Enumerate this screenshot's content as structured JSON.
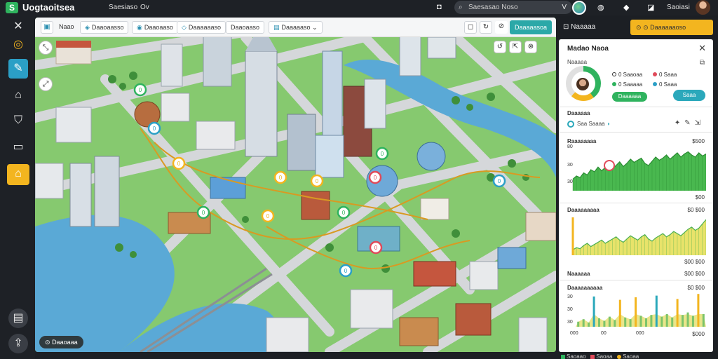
{
  "app": {
    "title": "Uogtaoitsea",
    "logo": "S"
  },
  "topbar": {
    "menu": [
      "Saesiaso",
      "Ov"
    ],
    "search_placeholder": "Saesasao Noso",
    "search_close": "V",
    "user_label": "Saoiasi"
  },
  "rail": {
    "icons": [
      "close-icon",
      "compass-icon",
      "ruler-icon",
      "layers-icon",
      "shield-icon",
      "tablet-icon",
      "building-icon",
      "save-icon",
      "share-icon"
    ]
  },
  "map_toolbar": {
    "items": [
      {
        "label": "Naao",
        "icon": "▣"
      },
      {
        "label": "Daaoaasso",
        "icon": "◈"
      },
      {
        "label": "Daaoaaso",
        "icon": "◉"
      },
      {
        "label": "Daaaaaaso",
        "icon": "◇"
      },
      {
        "label": "Daaoaaso",
        "icon": ""
      },
      {
        "label": "Daaaaaso",
        "icon": "▤"
      }
    ],
    "primary_label": "Daaaaasoa",
    "quick_icons": [
      "◻",
      "↻",
      "⊘"
    ]
  },
  "map": {
    "status": "Daaoaaa",
    "zoom_icons": [
      "↺",
      "⇱",
      "⊗"
    ],
    "markers": [
      {
        "glyph": "0",
        "color": "#2fb35e"
      },
      {
        "glyph": "0",
        "color": "#2b9fc6"
      },
      {
        "glyph": "0",
        "color": "#f3b51f"
      },
      {
        "glyph": "0",
        "color": "#f3b51f"
      },
      {
        "glyph": "0",
        "color": "#f3b51f"
      },
      {
        "glyph": "0",
        "color": "#2fb35e"
      },
      {
        "glyph": "0",
        "color": "#f3b51f"
      },
      {
        "glyph": "0",
        "color": "#2fb35e"
      },
      {
        "glyph": "0",
        "color": "#e04a5a"
      },
      {
        "glyph": "0",
        "color": "#2fb35e"
      },
      {
        "glyph": "0",
        "color": "#e04a5a"
      },
      {
        "glyph": "0",
        "color": "#2b9fc6"
      },
      {
        "glyph": "0",
        "color": "#2b9fc6"
      }
    ]
  },
  "right_header": {
    "tab_label": "Naaaaa",
    "tab_icon": "⊡",
    "yellow_label": "Daaaaaaoso",
    "yellow_icons": [
      "⊙",
      "⊙"
    ]
  },
  "panel": {
    "title": "Madao Naoa",
    "close": "✕",
    "subtitle": "Naaaaa",
    "stats": [
      {
        "label": "0 Saaoaa",
        "color": "#2fb35e"
      },
      {
        "label": "0 Saaa",
        "color": "#e04a5a"
      },
      {
        "label": "0 Saaaaa",
        "color": "#2fb35e"
      },
      {
        "label": "0 Saaa",
        "color": "#2b9fc6"
      }
    ],
    "green_btn": "Daaaaaa",
    "teal_btn": "Saaa",
    "section1": "Daaaaaa",
    "tools_label": "Saa Saaaa",
    "tools_icons": [
      "✦",
      "✎",
      "⇲"
    ],
    "charts": [
      {
        "title": "Raaaaaaaa",
        "value": "$500",
        "footer_right": "$00",
        "ticks": [
          "80",
          "30",
          "30"
        ]
      },
      {
        "title": "Daaaaaaaaa",
        "value": "$0 $00",
        "footer_right": "$00 $00",
        "footer_left": "Naaaaaa"
      },
      {
        "title": "Daaaaaaaaaa",
        "value": "$0 $00",
        "footer_right": "$000",
        "ticks": [
          "30",
          "30",
          "30"
        ],
        "x_ticks": [
          "000",
          "00",
          "000",
          "000"
        ]
      }
    ]
  },
  "footer": {
    "items": [
      {
        "label": "Saoaao",
        "color": "#2fb35e"
      },
      {
        "label": "Saoaa",
        "color": "#e04a5a"
      },
      {
        "label": "Saoaa",
        "color": "#f3b51f"
      }
    ]
  },
  "chart_data": [
    {
      "type": "area",
      "title": "Raaaaaaaa",
      "values": [
        22,
        28,
        25,
        34,
        30,
        40,
        36,
        45,
        38,
        44,
        50,
        42,
        48,
        55,
        46,
        52,
        60,
        54,
        58,
        62,
        52,
        48,
        56,
        64,
        58,
        62,
        68,
        60,
        66,
        72,
        64,
        70,
        74,
        68,
        64,
        72,
        66,
        70
      ]
    },
    {
      "type": "area",
      "title": "Daaaaaaaaa",
      "values": [
        10,
        14,
        12,
        18,
        22,
        16,
        20,
        24,
        28,
        22,
        26,
        30,
        34,
        28,
        24,
        30,
        36,
        32,
        28,
        34,
        38,
        30,
        26,
        32,
        36,
        40,
        34,
        38,
        44,
        40,
        36,
        42,
        48,
        52,
        46,
        50,
        58,
        66
      ]
    },
    {
      "type": "bar",
      "title": "Daaaaaaaaaa",
      "values": [
        12,
        18,
        10,
        72,
        20,
        14,
        24,
        16,
        64,
        22,
        18,
        70,
        26,
        20,
        28,
        74,
        24,
        30,
        22,
        66,
        28,
        34,
        26,
        78,
        30
      ]
    }
  ]
}
